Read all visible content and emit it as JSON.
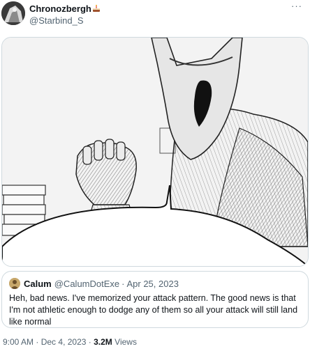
{
  "author": {
    "display_name": "Chronozbergh",
    "name_emoji_icon": "cake-emoji-icon",
    "handle": "@Starbind_S"
  },
  "more_label": "···",
  "quoted_tweet": {
    "author_name": "Calum",
    "author_handle": "@CalumDotExe",
    "separator": "·",
    "date": "Apr 25, 2023",
    "text": "Heh, bad news. I've memorized your attack pattern. The good news is that I'm not athletic enough to dodge any of them so all your attack will still land like normal"
  },
  "meta": {
    "time": "9:00 AM",
    "separator": "·",
    "date": "Dec 4, 2023",
    "separator2": "·",
    "views_count": "3.2M",
    "views_label": "Views"
  },
  "colors": {
    "text_primary": "#0f1419",
    "text_secondary": "#536471",
    "border": "#cfd9de"
  }
}
